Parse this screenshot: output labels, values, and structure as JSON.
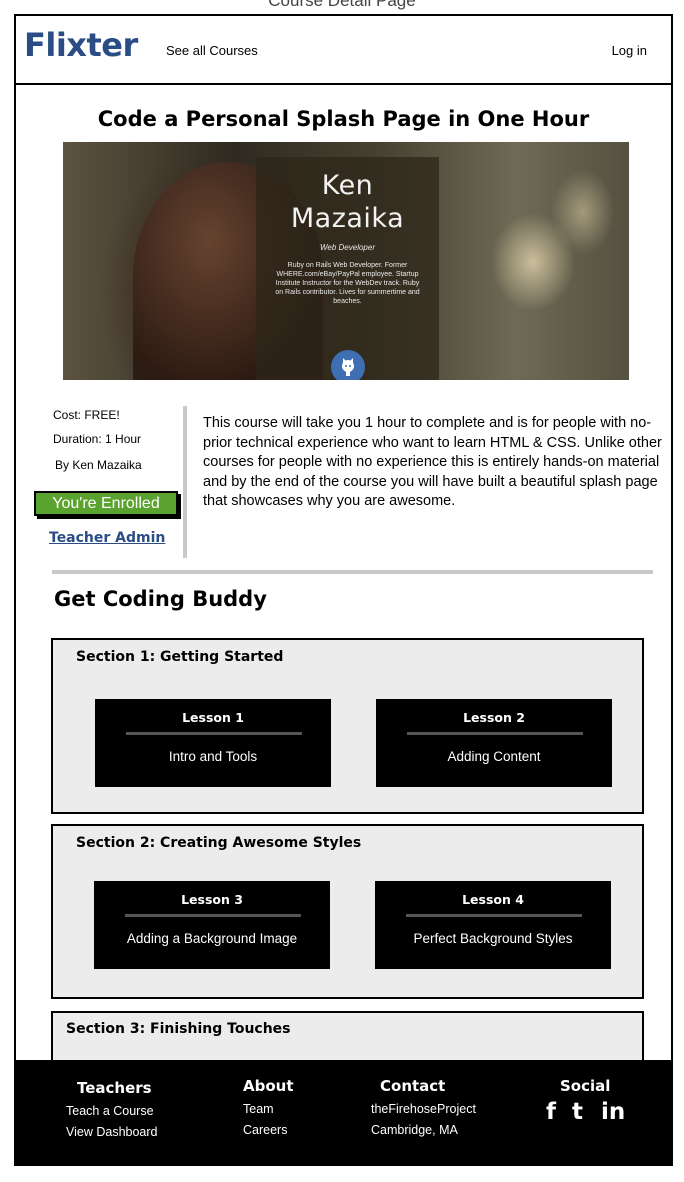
{
  "page_caption": "Course Detail Page",
  "header": {
    "logo": "Flixter",
    "nav_all_courses": "See all Courses",
    "nav_login": "Log in"
  },
  "course": {
    "title": "Code a Personal Splash Page in One Hour",
    "hero": {
      "name_line1": "Ken",
      "name_line2": "Mazaika",
      "role": "Web Developer",
      "bio": "Ruby on Rails Web Developer. Former WHERE.com/eBay/PayPal employee. Startup Institute Instructor for the WebDev track. Ruby on Rails contributor. Lives for summertime and beaches.",
      "github_icon": "github-octocat-icon"
    },
    "cost": "Cost: FREE!",
    "duration": "Duration:  1 Hour",
    "author": "By Ken Mazaika",
    "enrolled_button": "You're Enrolled",
    "teacher_admin": "Teacher Admin",
    "description": "This course will take you 1 hour to complete and is for people with no-prior technical experience who want to learn HTML & CSS. Unlike other courses for people with no experience this is entirely hands-on material and by the end of the course you will have built a beautiful splash page that showcases why you are awesome."
  },
  "curriculum": {
    "heading": "Get Coding Buddy",
    "sections": [
      {
        "title": "Section 1: Getting Started",
        "lessons": [
          {
            "number": "Lesson 1",
            "name": "Intro and Tools"
          },
          {
            "number": "Lesson 2",
            "name": "Adding Content"
          }
        ]
      },
      {
        "title": "Section 2: Creating Awesome Styles",
        "lessons": [
          {
            "number": "Lesson 3",
            "name": "Adding a Background Image"
          },
          {
            "number": "Lesson 4",
            "name": "Perfect Background Styles"
          }
        ]
      },
      {
        "title": "Section 3: Finishing Touches",
        "lessons": []
      }
    ]
  },
  "footer": {
    "teachers": {
      "heading": "Teachers",
      "links": [
        "Teach a Course",
        "View Dashboard"
      ]
    },
    "about": {
      "heading": "About",
      "links": [
        "Team",
        "Careers"
      ]
    },
    "contact": {
      "heading": "Contact",
      "lines": [
        "theFirehoseProject",
        "Cambridge, MA"
      ]
    },
    "social": {
      "heading": "Social",
      "icons": [
        "facebook-icon",
        "twitter-icon",
        "linkedin-icon"
      ]
    }
  },
  "colors": {
    "brand": "#2a4d86",
    "enrolled": "#5aa32e",
    "section_bg": "#ececec",
    "lesson_bg": "#000000"
  }
}
